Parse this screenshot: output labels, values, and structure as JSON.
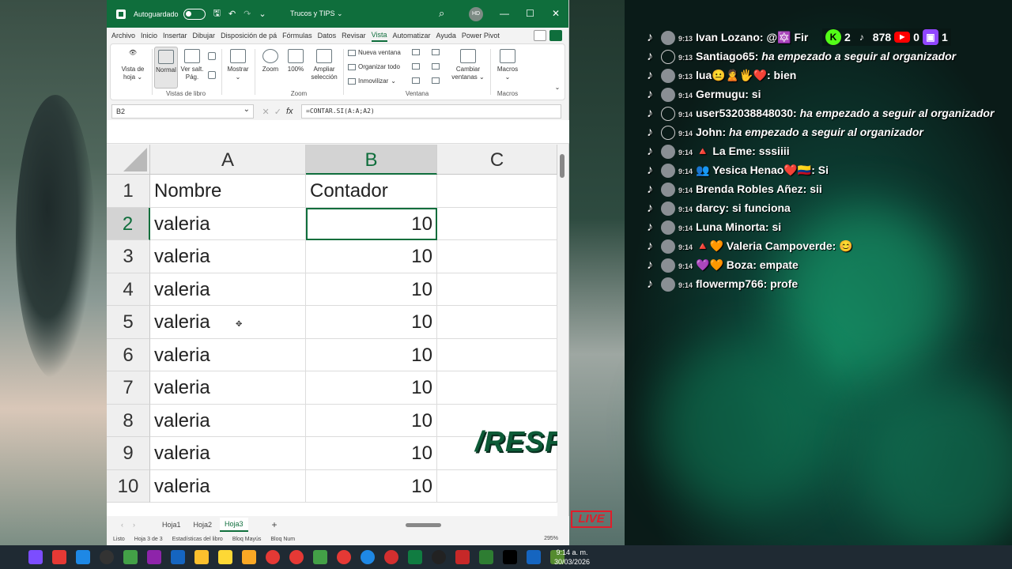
{
  "window": {
    "autosave_label": "Autoguardado",
    "file_title": "Trucos y TIPS",
    "user_initials": "HD"
  },
  "menu": {
    "tabs": [
      "Archivo",
      "Inicio",
      "Insertar",
      "Dibujar",
      "Disposición de pá",
      "Fórmulas",
      "Datos",
      "Revisar",
      "Vista",
      "Automatizar",
      "Ayuda",
      "Power Pivot"
    ],
    "active": "Vista"
  },
  "ribbon": {
    "vista_de_hoja": "Vista de hoja",
    "normal": "Normal",
    "ver_salt": "Ver salt. Pág.",
    "mostrar": "Mostrar",
    "zoom": "Zoom",
    "zoom100": "100%",
    "ampliar": "Ampliar selección",
    "nueva_ventana": "Nueva ventana",
    "organizar_todo": "Organizar todo",
    "inmovilizar": "Inmovilizar",
    "cambiar_ventanas": "Cambiar ventanas",
    "macros": "Macros",
    "groups": {
      "vistas": "Vistas de libro",
      "zoom": "Zoom",
      "ventana": "Ventana",
      "macros": "Macros"
    }
  },
  "formula_bar": {
    "name_box": "B2",
    "formula": "=CONTAR.SI(A:A;A2)"
  },
  "grid": {
    "columns": [
      "A",
      "B",
      "C"
    ],
    "rows": [
      {
        "n": "1",
        "a": "Nombre",
        "b": "Contador"
      },
      {
        "n": "2",
        "a": "valeria",
        "b": "10"
      },
      {
        "n": "3",
        "a": "valeria",
        "b": "10"
      },
      {
        "n": "4",
        "a": "valeria",
        "b": "10"
      },
      {
        "n": "5",
        "a": "valeria",
        "b": "10"
      },
      {
        "n": "6",
        "a": "valeria",
        "b": "10"
      },
      {
        "n": "7",
        "a": "valeria",
        "b": "10"
      },
      {
        "n": "8",
        "a": "valeria",
        "b": "10"
      },
      {
        "n": "9",
        "a": "valeria",
        "b": "10"
      },
      {
        "n": "10",
        "a": "valeria",
        "b": "10"
      }
    ],
    "overlay_text": "/RESP"
  },
  "sheets": [
    "Hoja1",
    "Hoja2",
    "Hoja3"
  ],
  "active_sheet": "Hoja3",
  "status": {
    "ready": "Listo",
    "sheet_of": "Hoja 3 de 3",
    "stats": "Estadísticas del libro",
    "bloq_mayus": "Bloq Mayús",
    "bloq_num": "Bloq Num",
    "zoom": "295%"
  },
  "stream": {
    "live_badge": "LIVE",
    "stats": {
      "kick": "2",
      "tiktok": "878",
      "youtube": "0",
      "twitch": "1"
    },
    "chat": [
      {
        "time": "9:13",
        "user": "Ivan Lozano:",
        "text": "@🔯 Fir",
        "italic": false,
        "anon": false
      },
      {
        "time": "9:13",
        "user": "Santiago65:",
        "text": "ha empezado a seguir al organizador",
        "italic": true,
        "anon": true
      },
      {
        "time": "9:13",
        "user": "lua😐🙎🖐❤️:",
        "text": "bien",
        "italic": false,
        "anon": false
      },
      {
        "time": "9:14",
        "user": "Germugu:",
        "text": "si",
        "italic": false,
        "anon": false
      },
      {
        "time": "9:14",
        "user": "user532038848030:",
        "text": "ha empezado a seguir al organizador",
        "italic": true,
        "anon": true
      },
      {
        "time": "9:14",
        "user": "John:",
        "text": "ha empezado a seguir al organizador",
        "italic": true,
        "anon": true
      },
      {
        "time": "9:14",
        "user": "🔺 La Eme:",
        "text": "sssiiii",
        "italic": false,
        "anon": false
      },
      {
        "time": "9:14",
        "user": "👥 Yesica Henao❤️🇨🇴:",
        "text": "Si",
        "italic": false,
        "anon": false
      },
      {
        "time": "9:14",
        "user": "Brenda Robles Añez:",
        "text": "sii",
        "italic": false,
        "anon": false
      },
      {
        "time": "9:14",
        "user": "darcy:",
        "text": "si funciona",
        "italic": false,
        "anon": false
      },
      {
        "time": "9:14",
        "user": "Luna Minorta:",
        "text": "si",
        "italic": false,
        "anon": false
      },
      {
        "time": "9:14",
        "user": "🔺🧡 Valeria Campoverde:",
        "text": "😊",
        "italic": false,
        "anon": false
      },
      {
        "time": "9:14",
        "user": "💜🧡 Boza:",
        "text": "empate",
        "italic": false,
        "anon": false
      },
      {
        "time": "9:14",
        "user": "flowermp766:",
        "text": "profe",
        "italic": false,
        "anon": false
      }
    ]
  },
  "taskbar": {
    "time": "9:14 a. m.",
    "date": "30/03/2026"
  },
  "colors": {
    "excel_green": "#0f6e3c",
    "live_red": "#e01d2a"
  }
}
